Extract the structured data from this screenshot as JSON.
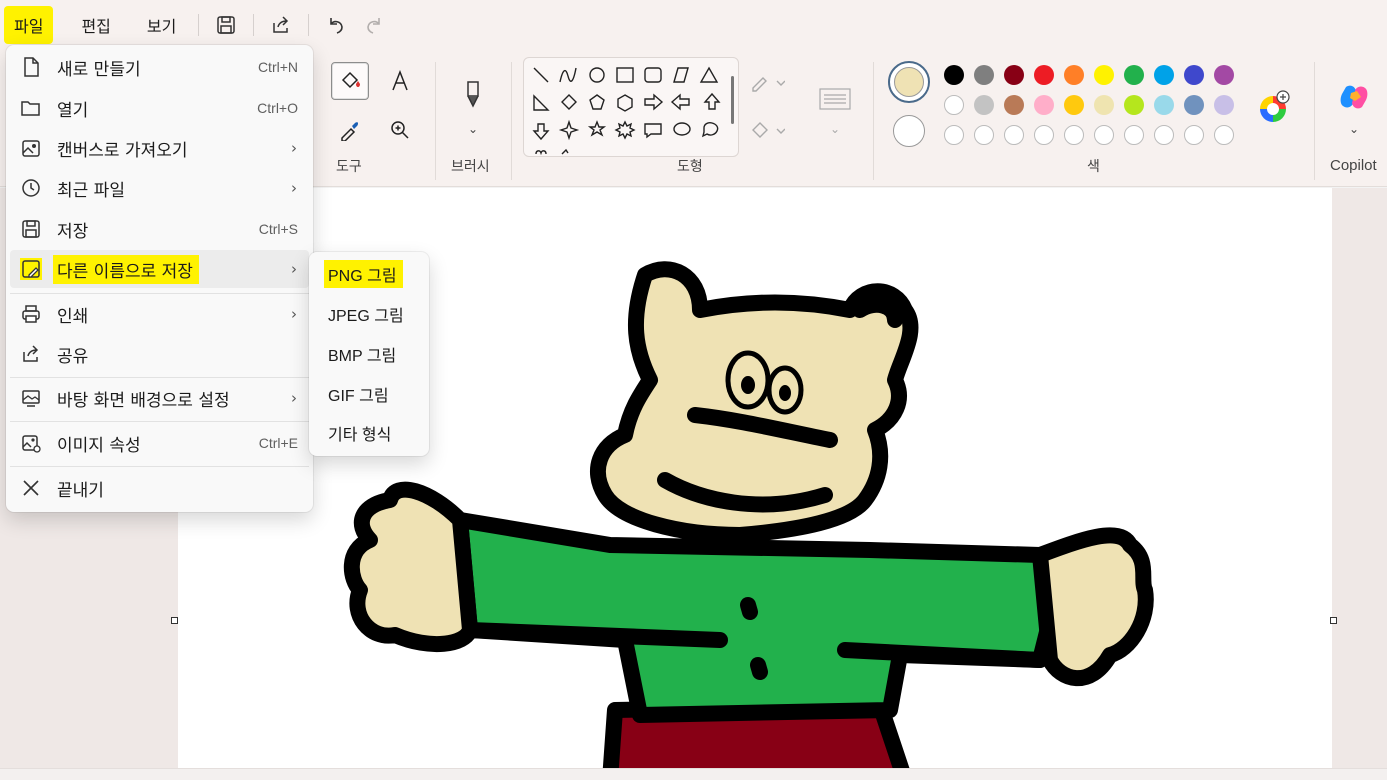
{
  "menubar": {
    "file": "파일",
    "edit": "편집",
    "view": "보기",
    "icons": [
      "save-icon",
      "share-icon",
      "undo-icon",
      "redo-icon"
    ]
  },
  "ribbon": {
    "tools_label": "도구",
    "brush_label": "브러시",
    "shapes_label": "도형",
    "colors_label": "색",
    "copilot_label": "Copilot",
    "primary_color": "#efe2b4",
    "secondary_color": "#ffffff",
    "palette_row1": [
      "#000000",
      "#7f7f7f",
      "#880015",
      "#ed1c24",
      "#ff7f27",
      "#fff200",
      "#22b14c",
      "#00a2e8",
      "#3f48cc",
      "#a349a4"
    ],
    "palette_row2": [
      "#ffffff",
      "#c3c3c3",
      "#b97a57",
      "#ffaec9",
      "#ffc90e",
      "#efe4b0",
      "#b5e61d",
      "#99d9ea",
      "#7092be",
      "#c8bfe7"
    ]
  },
  "file_menu": {
    "items": [
      {
        "label": "새로 만들기",
        "shortcut": "Ctrl+N",
        "icon": "new-file-icon"
      },
      {
        "label": "열기",
        "shortcut": "Ctrl+O",
        "icon": "folder-open-icon"
      },
      {
        "label": "캔버스로 가져오기",
        "submenu": true,
        "icon": "import-image-icon"
      },
      {
        "label": "최근 파일",
        "submenu": true,
        "icon": "clock-icon"
      },
      {
        "label": "저장",
        "shortcut": "Ctrl+S",
        "icon": "save-icon"
      },
      {
        "label": "다른 이름으로 저장",
        "submenu": true,
        "icon": "save-as-icon"
      },
      {
        "label": "인쇄",
        "submenu": true,
        "icon": "printer-icon"
      },
      {
        "label": "공유",
        "icon": "share-icon"
      },
      {
        "label": "바탕 화면 배경으로 설정",
        "submenu": true,
        "icon": "wallpaper-icon"
      },
      {
        "label": "이미지 속성",
        "shortcut": "Ctrl+E",
        "icon": "image-properties-icon"
      },
      {
        "label": "끝내기",
        "icon": "close-icon"
      }
    ],
    "arrow": "›"
  },
  "save_as_menu": {
    "items": [
      "PNG 그림",
      "JPEG 그림",
      "BMP 그림",
      "GIF 그림",
      "기타 형식"
    ]
  }
}
